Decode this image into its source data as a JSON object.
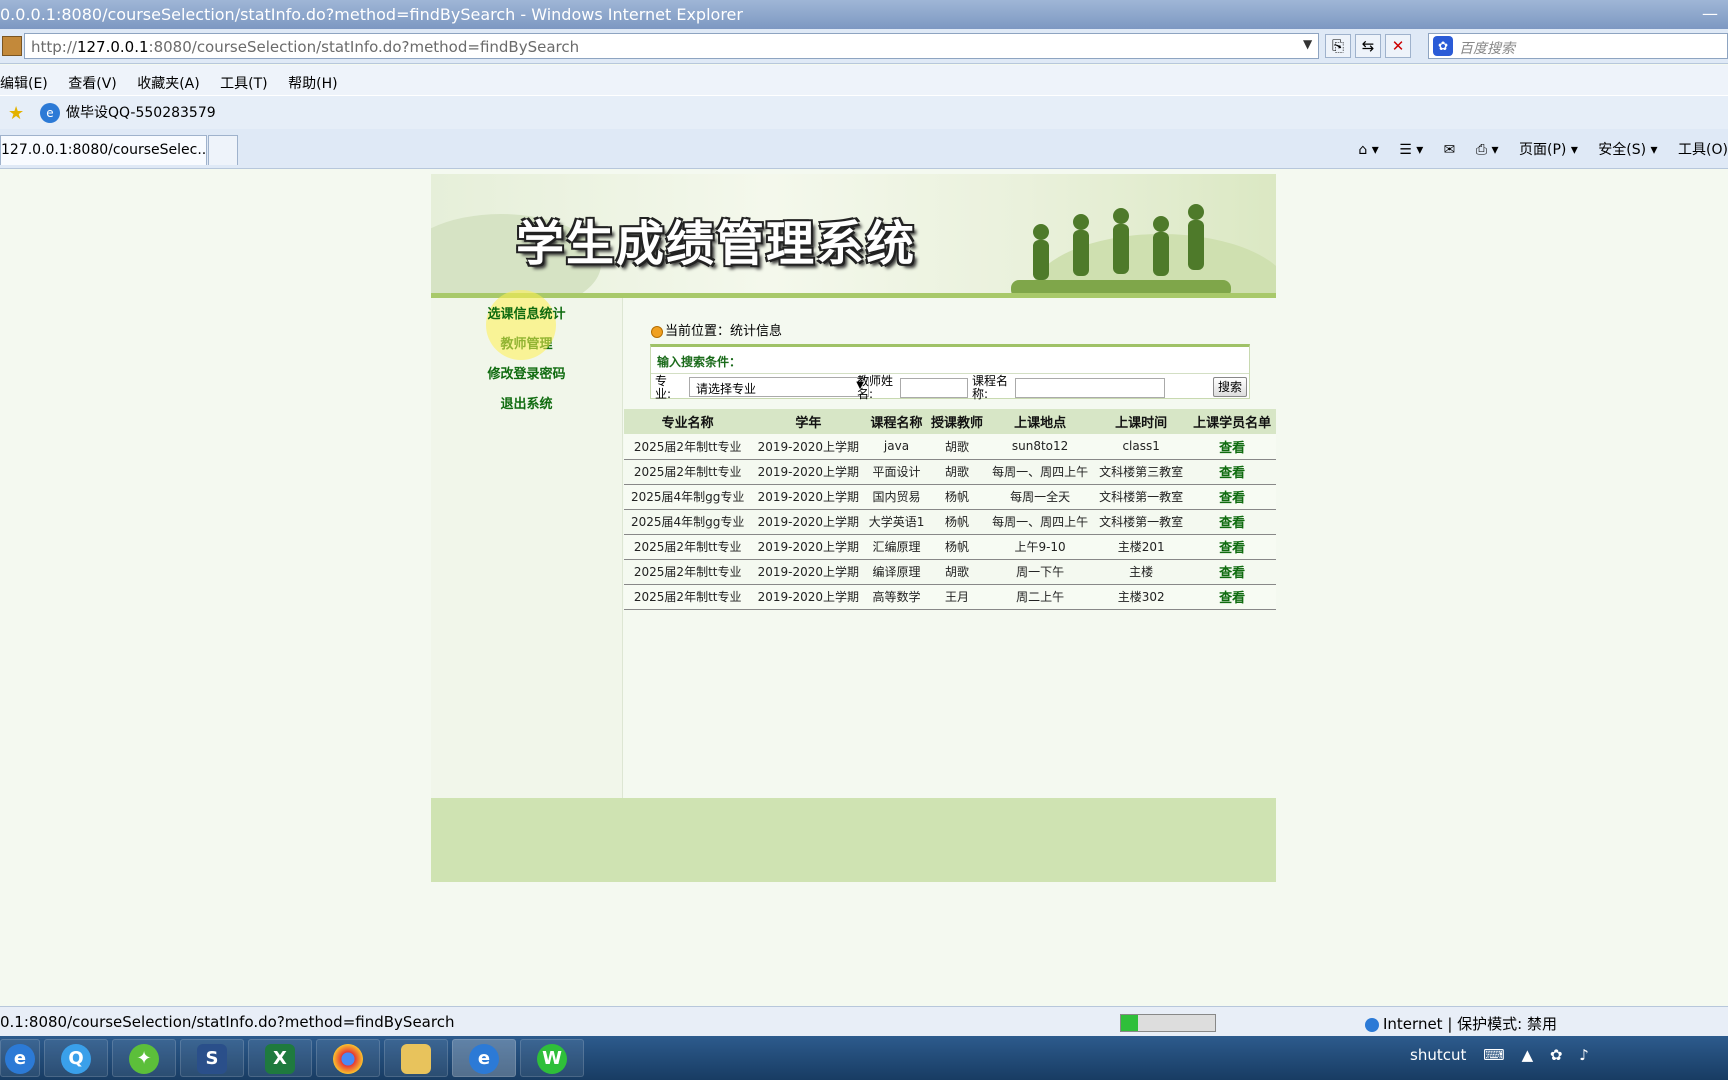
{
  "window": {
    "title": "0.0.0.1:8080/courseSelection/statInfo.do?method=findBySearch - Windows Internet Explorer",
    "minimize": "—"
  },
  "addressbar": {
    "url_prefix": "http://",
    "url_host": "127.0.0.1",
    "url_rest": ":8080/courseSelection/statInfo.do?method=findBySearch",
    "search_placeholder": "百度搜索"
  },
  "menubar": {
    "items": [
      "编辑(E)",
      "查看(V)",
      "收藏夹(A)",
      "工具(T)",
      "帮助(H)"
    ]
  },
  "favorites": {
    "item": "做毕设QQ-550283579"
  },
  "tabs": {
    "active": "127.0.0.1:8080/courseSelec...",
    "cmd": [
      "页面(P) ▾",
      "安全(S) ▾",
      "工具(O)"
    ]
  },
  "page": {
    "banner_title": "学生成绩管理系统",
    "sidebar": [
      "选课信息统计",
      "教师管理",
      "修改登录密码",
      "退出系统"
    ],
    "location_label": "当前位置：统计信息",
    "search": {
      "title": "输入搜索条件：",
      "major_label": "专业:",
      "major_selected": "请选择专业",
      "teacher_label": "教师姓名:",
      "course_label": "课程名称:",
      "button": "搜索"
    },
    "table": {
      "headers": [
        "专业名称",
        "学年",
        "课程名称",
        "授课教师",
        "上课地点",
        "上课时间",
        "上课学员名单"
      ],
      "rows": [
        [
          "2025届2年制tt专业",
          "2019-2020上学期",
          "java",
          "胡歌",
          "sun8to12",
          "class1",
          "查看"
        ],
        [
          "2025届2年制tt专业",
          "2019-2020上学期",
          "平面设计",
          "胡歌",
          "每周一、周四上午",
          "文科楼第三教室",
          "查看"
        ],
        [
          "2025届4年制gg专业",
          "2019-2020上学期",
          "国内贸易",
          "杨帆",
          "每周一全天",
          "文科楼第一教室",
          "查看"
        ],
        [
          "2025届4年制gg专业",
          "2019-2020上学期",
          "大学英语1",
          "杨帆",
          "每周一、周四上午",
          "文科楼第一教室",
          "查看"
        ],
        [
          "2025届2年制tt专业",
          "2019-2020上学期",
          "汇编原理",
          "杨帆",
          "上午9-10",
          "主楼201",
          "查看"
        ],
        [
          "2025届2年制tt专业",
          "2019-2020上学期",
          "编译原理",
          "胡歌",
          "周一下午",
          "主楼",
          "查看"
        ],
        [
          "2025届2年制tt专业",
          "2019-2020上学期",
          "高等数学",
          "王月",
          "周二上午",
          "主楼302",
          "查看"
        ]
      ]
    }
  },
  "statusbar": {
    "url": "0.1:8080/courseSelection/statInfo.do?method=findBySearch",
    "zone": "Internet | 保护模式: 禁用",
    "progress": 0.18
  },
  "taskbar": {
    "apps": [
      "ie-icon",
      "qq-icon",
      "tool-icon",
      "s-icon",
      "excel-icon",
      "chrome-icon",
      "folder-icon",
      "ie-icon",
      "wechat-icon"
    ],
    "tray_label": "shutcut"
  },
  "colors": {
    "accent_green": "#0f6b0f",
    "banner_border": "#a8c96a",
    "footer": "#cfe3b2"
  }
}
